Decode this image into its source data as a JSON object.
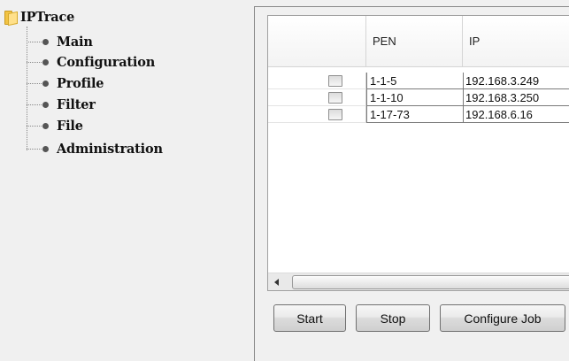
{
  "tree": {
    "root_label": "IPTrace",
    "items": [
      {
        "label": "Main"
      },
      {
        "label": "Configuration"
      },
      {
        "label": "Profile"
      },
      {
        "label": "Filter"
      },
      {
        "label": "File"
      },
      {
        "label": "Administration"
      }
    ]
  },
  "table": {
    "columns": [
      "",
      "PEN",
      "IP"
    ],
    "rows": [
      {
        "checked": false,
        "pen": "1-1-5",
        "ip": "192.168.3.249"
      },
      {
        "checked": false,
        "pen": "1-1-10",
        "ip": "192.168.3.250"
      },
      {
        "checked": false,
        "pen": "1-17-73",
        "ip": "192.168.6.16"
      }
    ]
  },
  "buttons": {
    "start_label": "Start",
    "stop_label": "Stop",
    "configure_label": "Configure Job"
  },
  "icons": {
    "root": "folder-icon",
    "tree_bullet": "bullet-icon",
    "scroll_left": "chevron-left-icon"
  }
}
